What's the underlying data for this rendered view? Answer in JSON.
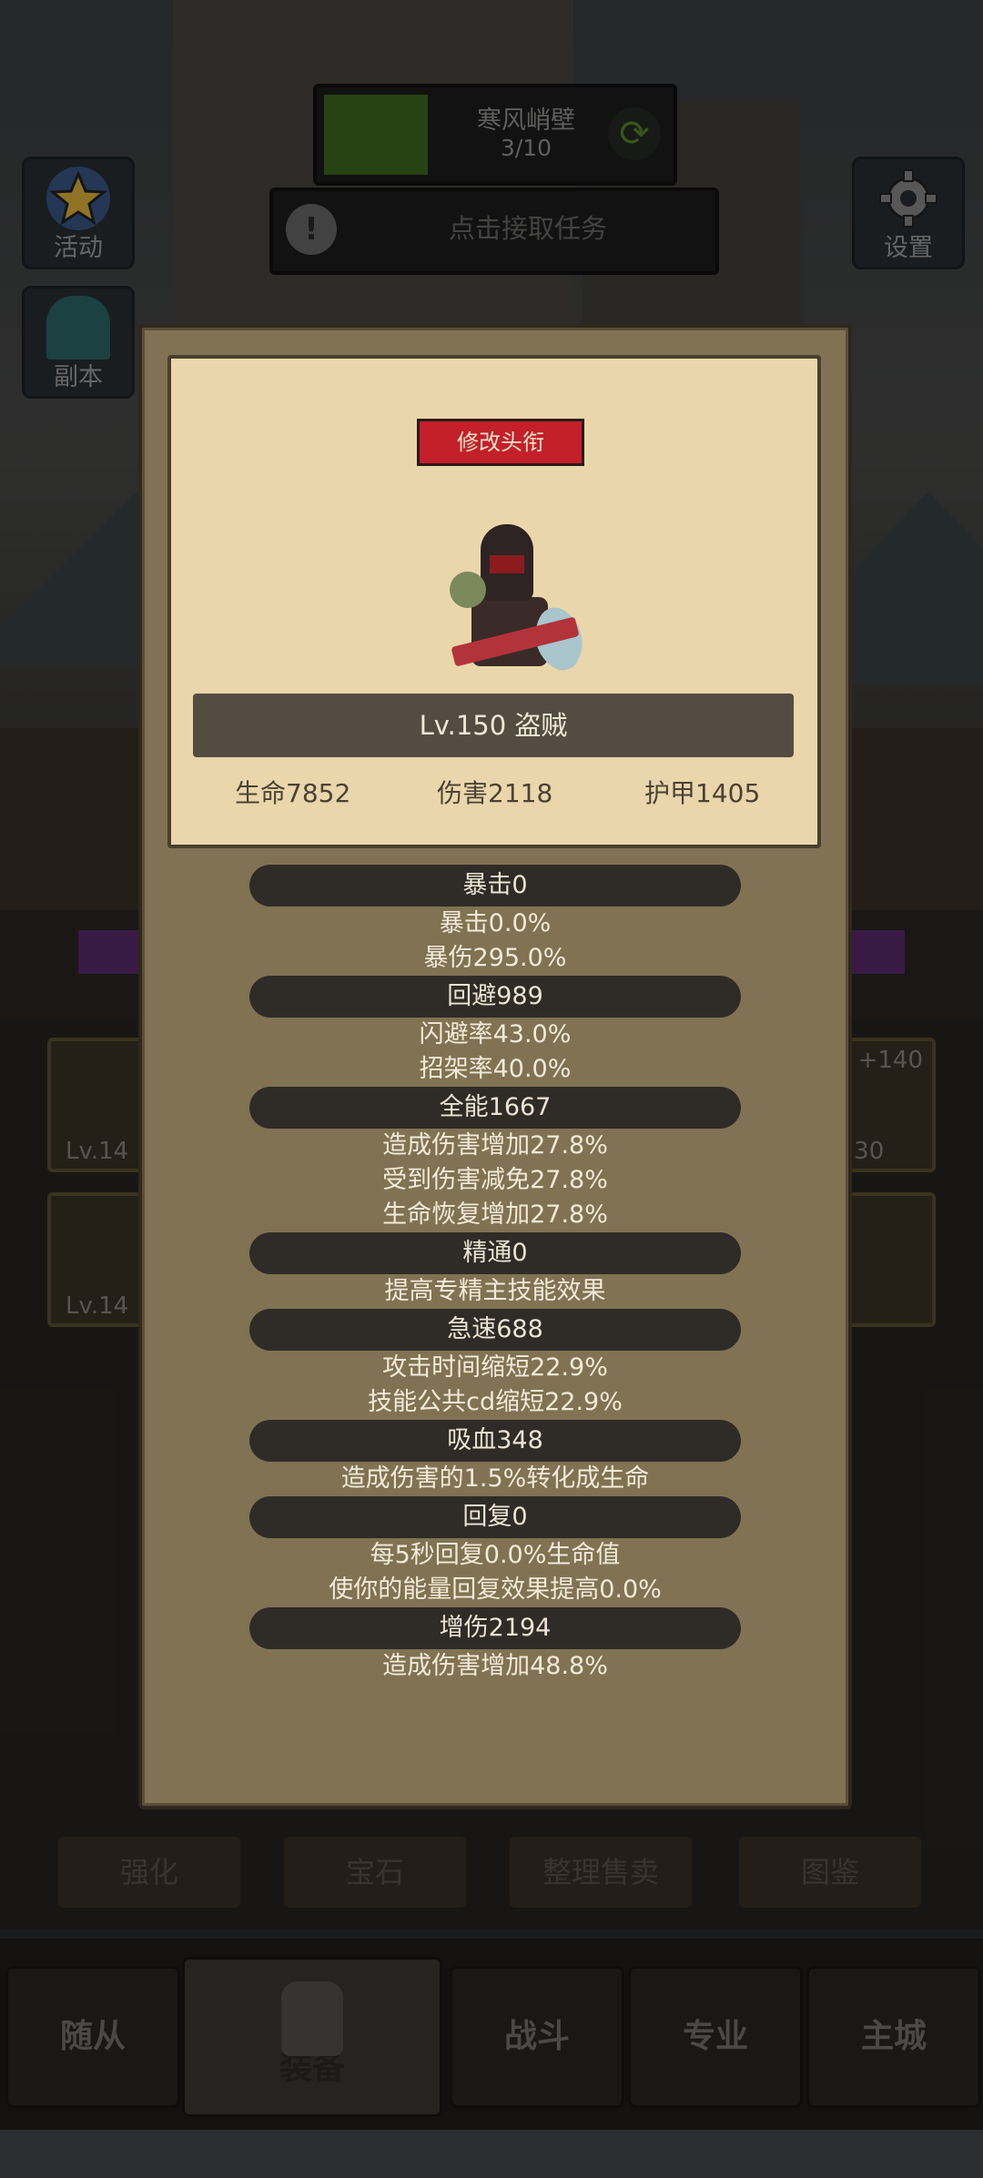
{
  "hud": {
    "stage_name": "寒风峭壁",
    "stage_progress": "3/10",
    "swap_icon": "refresh-arrows",
    "quest_text": "点击接取任务",
    "quest_icon": "exclamation",
    "activities_label": "活动",
    "dungeon_label": "副本",
    "settings_label": "设置"
  },
  "equipment": {
    "slots": [
      {
        "lv": "Lv.14",
        "plus": "+"
      },
      {
        "lv": "Lv.14",
        "plus": ""
      },
      {
        "lv": "v.130",
        "plus": "+140"
      },
      {
        "lv": "",
        "plus": ""
      }
    ],
    "actions": [
      "强化",
      "宝石",
      "整理售卖",
      "图鉴"
    ]
  },
  "tabs": [
    "随从",
    "装备",
    "战斗",
    "专业",
    "主城"
  ],
  "modal": {
    "rename_button": "修改头衔",
    "hero_name": "Lv.150 盗贼",
    "base": {
      "hp": "生命7852",
      "damage": "伤害2118",
      "armor": "护甲1405"
    },
    "groups": [
      {
        "header": "暴击0",
        "lines": [
          "暴击0.0%",
          "暴伤295.0%"
        ]
      },
      {
        "header": "回避989",
        "lines": [
          "闪避率43.0%",
          "招架率40.0%"
        ]
      },
      {
        "header": "全能1667",
        "lines": [
          "造成伤害增加27.8%",
          "受到伤害减免27.8%",
          "生命恢复增加27.8%"
        ]
      },
      {
        "header": "精通0",
        "lines": [
          "提高专精主技能效果"
        ]
      },
      {
        "header": "急速688",
        "lines": [
          "攻击时间缩短22.9%",
          "技能公共cd缩短22.9%"
        ]
      },
      {
        "header": "吸血348",
        "lines": [
          "造成伤害的1.5%转化成生命"
        ]
      },
      {
        "header": "回复0",
        "lines": [
          "每5秒回复0.0%生命值",
          "使你的能量回复效果提高0.0%"
        ]
      },
      {
        "header": "增伤2194",
        "lines": [
          "造成伤害增加48.8%"
        ]
      }
    ]
  },
  "colors": {
    "modal_bg": "#817253",
    "card_bg": "#ead6ab",
    "rename_red": "#c4202b",
    "header_dark": "#2f2c28"
  }
}
